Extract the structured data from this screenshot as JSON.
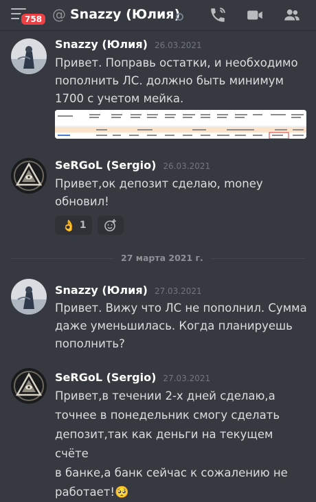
{
  "header": {
    "badge_count": "758",
    "at_symbol": "@",
    "title": "Snazzy (Юлия)",
    "icons": [
      "menu-icon",
      "phone-icon",
      "video-icon",
      "members-icon"
    ]
  },
  "messages": [
    {
      "author": "Snazzy (Юлия)",
      "date": "26.03.2021",
      "lines": [
        "Привет. Поправь остатки, и необходимо",
        "пополнить ЛС. должно быть минимум",
        "1700 с учетом мейка."
      ]
    },
    {
      "author": "SeRGoL (Sergio)",
      "date": "26.03.2021",
      "lines": [
        "Привет,ок депозит сделаю, money",
        "обновил!"
      ],
      "reaction": {
        "emoji": "👌",
        "count": "1"
      }
    },
    {
      "author": "Snazzy (Юлия)",
      "date": "27.03.2021",
      "lines": [
        "Привет. Вижу что ЛС не пополнил. Сумма",
        "даже уменьшилась. Когда планируешь",
        "пополнить?"
      ]
    },
    {
      "author": "SeRGoL (Sergio)",
      "date": "27.03.2021",
      "lines": [
        "Привет,в течении 2-х дней сделаю,а",
        "точнее в понедельник смогу сделать",
        "депозит,так как деньги на текущем счёте",
        "в банке,а банк сейчас к сожалению не",
        "работает!🥺"
      ]
    }
  ],
  "date_divider": "27 марта 2021 г.",
  "colors": {
    "background": "#36393f",
    "badge": "#ed4245",
    "accent": "#5865f2"
  }
}
